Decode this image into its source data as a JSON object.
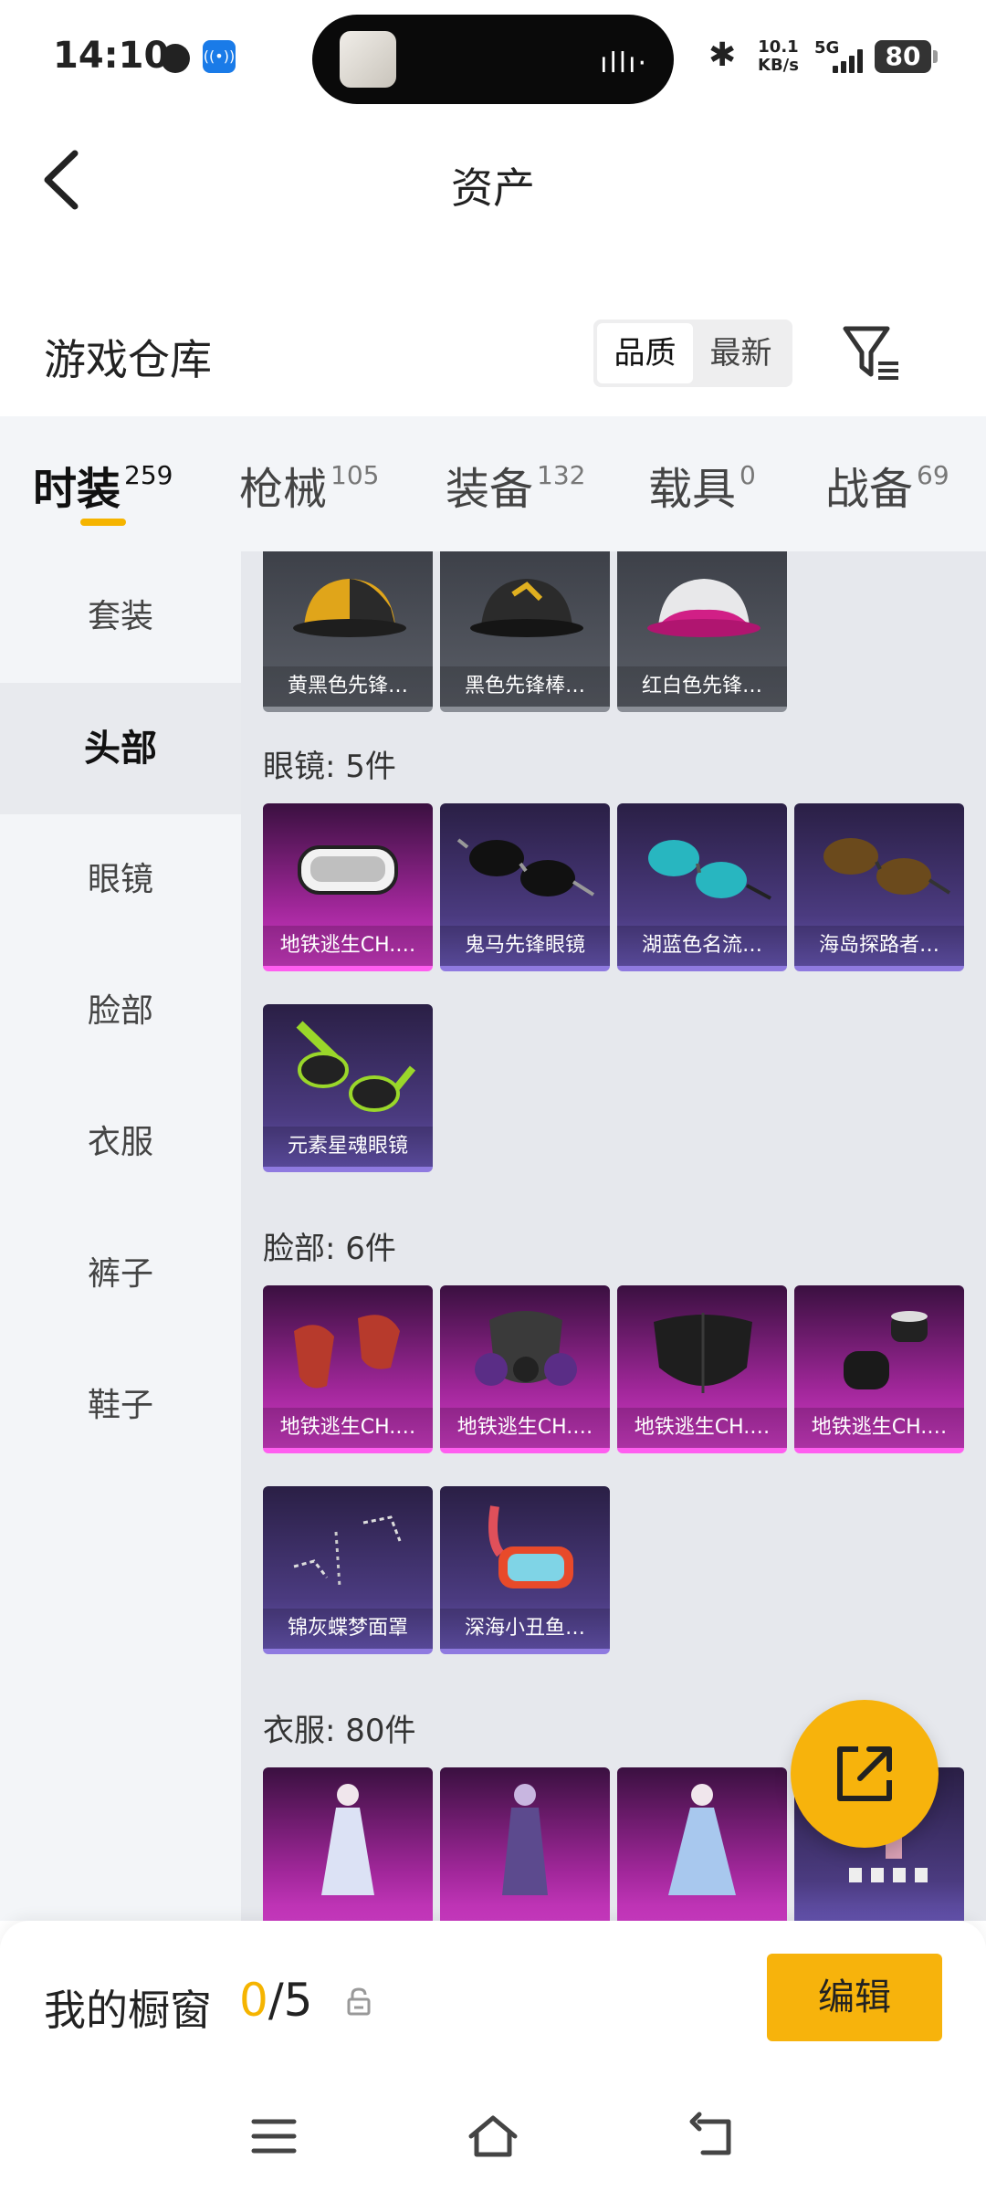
{
  "status_bar": {
    "time": "14:10",
    "radio_badge": "((•))",
    "speed_value": "10.1",
    "speed_unit": "KB/s",
    "network": "5G",
    "battery": "80"
  },
  "header": {
    "title": "资产"
  },
  "warehouse": {
    "title": "游戏仓库",
    "sort_options": [
      "品质",
      "最新"
    ],
    "sort_selected": "品质"
  },
  "tabs": [
    {
      "label": "时装",
      "count": "259"
    },
    {
      "label": "枪械",
      "count": "105"
    },
    {
      "label": "装备",
      "count": "132"
    },
    {
      "label": "载具",
      "count": "0"
    },
    {
      "label": "战备",
      "count": "69"
    }
  ],
  "sidebar": {
    "items": [
      "套装",
      "头部",
      "眼镜",
      "脸部",
      "衣服",
      "裤子",
      "鞋子"
    ],
    "active": "头部"
  },
  "sections": [
    {
      "title": "",
      "items": [
        {
          "label": "黄黑色先锋…",
          "icon": "cap-icon"
        },
        {
          "label": "黑色先锋棒…",
          "icon": "cap-icon"
        },
        {
          "label": "红白色先锋…",
          "icon": "cap-icon"
        }
      ]
    },
    {
      "title": "眼镜: 5件",
      "items": [
        {
          "label": "地铁逃生CH.…",
          "icon": "goggles-icon"
        },
        {
          "label": "鬼马先锋眼镜",
          "icon": "sunglasses-icon"
        },
        {
          "label": "湖蓝色名流…",
          "icon": "sunglasses-icon"
        },
        {
          "label": "海岛探路者…",
          "icon": "sunglasses-icon"
        },
        {
          "label": "元素星魂眼镜",
          "icon": "sunglasses-icon"
        }
      ]
    },
    {
      "title": "脸部: 6件",
      "items": [
        {
          "label": "地铁逃生CH.…",
          "icon": "bandana-icon"
        },
        {
          "label": "地铁逃生CH.…",
          "icon": "gas-mask-icon"
        },
        {
          "label": "地铁逃生CH.…",
          "icon": "face-mask-icon"
        },
        {
          "label": "地铁逃生CH.…",
          "icon": "neck-gaiter-icon"
        },
        {
          "label": "锦灰蝶梦面罩",
          "icon": "butterfly-mask-icon"
        },
        {
          "label": "深海小丑鱼…",
          "icon": "snorkel-icon"
        }
      ]
    },
    {
      "title": "衣服: 80件",
      "items": [
        {
          "label": "",
          "icon": "outfit-icon"
        },
        {
          "label": "",
          "icon": "outfit-icon"
        },
        {
          "label": "",
          "icon": "outfit-icon"
        },
        {
          "label": "",
          "icon": "outfit-icon"
        }
      ]
    }
  ],
  "showcase": {
    "label": "我的橱窗",
    "current": "0",
    "total": "/5",
    "edit_label": "编辑"
  },
  "colors": {
    "accent": "#f7b30c",
    "tab_indicator": "#f5b400",
    "purple_card": "#4b3b80",
    "magenta_card": "#a2279b"
  }
}
